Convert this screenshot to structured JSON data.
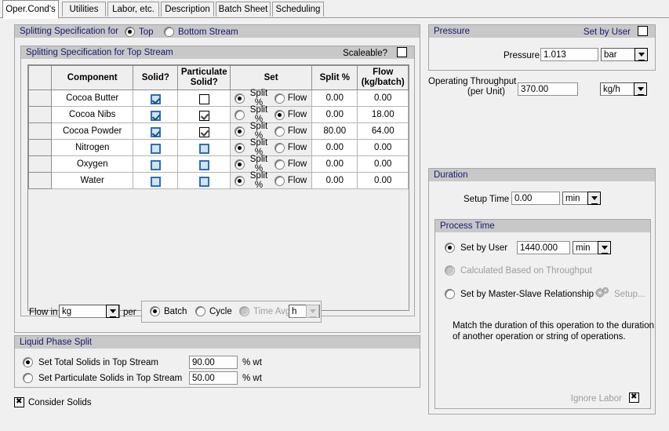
{
  "tabs": [
    {
      "label": "Oper.Cond's",
      "active": true
    },
    {
      "label": "Utilities",
      "active": false
    },
    {
      "label": "Labor, etc.",
      "active": false
    },
    {
      "label": "Description",
      "active": false
    },
    {
      "label": "Batch Sheet",
      "active": false
    },
    {
      "label": "Scheduling",
      "active": false
    }
  ],
  "splitting": {
    "title": "Splitting Specification for",
    "option_top": "Top",
    "option_bottom": "Bottom Stream",
    "selected": "Top",
    "inner_title": "Splitting Specification for Top Stream",
    "scaleable_label": "Scaleable?",
    "scaleable_checked": false,
    "columns": [
      "",
      "Component",
      "Solid?",
      "Particulate Solid?",
      "Set",
      "Split %",
      "Flow (kg/batch)"
    ],
    "column_flow_line1": "Flow",
    "column_flow_line2": "(kg/batch)",
    "column_part_line1": "Particulate",
    "column_part_line2": "Solid?",
    "set_option_split": "Split %",
    "set_option_flow": "Flow",
    "rows": [
      {
        "component": "Cocoa Butter",
        "solid": "blue-checked",
        "particulate": "black-unchecked",
        "set": "Split %",
        "split_pct": "0.00",
        "flow": "0.00"
      },
      {
        "component": "Cocoa Nibs",
        "solid": "blue-checked",
        "particulate": "black-checked",
        "set": "Flow",
        "split_pct": "0.00",
        "flow": "18.00"
      },
      {
        "component": "Cocoa Powder",
        "solid": "blue-checked",
        "particulate": "black-checked",
        "set": "Split %",
        "split_pct": "80.00",
        "flow": "64.00"
      },
      {
        "component": "Nitrogen",
        "solid": "blue-empty",
        "particulate": "blue-empty",
        "set": "Split %",
        "split_pct": "0.00",
        "flow": "0.00"
      },
      {
        "component": "Oxygen",
        "solid": "blue-empty",
        "particulate": "blue-empty",
        "set": "Split %",
        "split_pct": "0.00",
        "flow": "0.00"
      },
      {
        "component": "Water",
        "solid": "blue-empty",
        "particulate": "blue-empty",
        "set": "Split %",
        "split_pct": "0.00",
        "flow": "0.00"
      }
    ],
    "flow_in_label": "Flow in",
    "flow_in_value": "kg",
    "per_label": "per",
    "basis_batch": "Batch",
    "basis_cycle": "Cycle",
    "basis_timeavg": "Time Avg",
    "basis_selected": "Batch",
    "timeavg_unit": "h"
  },
  "liquid_phase": {
    "title": "Liquid Phase Split",
    "option_total": "Set Total Solids in Top Stream",
    "option_total_value": "90.00",
    "option_total_unit": "% wt",
    "option_particulate": "Set Particulate Solids in Top Stream",
    "option_particulate_value": "50.00",
    "option_particulate_unit": "% wt",
    "selected": "Set Total Solids in Top Stream"
  },
  "consider_solids": {
    "label": "Consider Solids",
    "checked": true
  },
  "pressure": {
    "title": "Pressure",
    "set_by_user_label": "Set by User",
    "set_by_user_checked": false,
    "field_label": "Pressure",
    "value": "1.013",
    "unit": "bar"
  },
  "throughput": {
    "label_line1": "Operating Throughput",
    "label_line2": "(per Unit)",
    "value": "370.00",
    "unit": "kg/h"
  },
  "duration": {
    "title": "Duration",
    "setup_time_label": "Setup Time",
    "setup_time_value": "0.00",
    "setup_time_unit": "min",
    "process_time": {
      "title": "Process Time",
      "option_user": "Set by User",
      "user_value": "1440.000",
      "user_unit": "min",
      "option_calculated": "Calculated Based on Throughput",
      "option_master_slave": "Set by Master-Slave Relationship",
      "setup_button": "Setup...",
      "selected": "Set by User",
      "description_line1": "Match the duration of this operation to the duration",
      "description_line2": "of another operation or string of operations.",
      "ignore_labor_label": "Ignore Labor",
      "ignore_labor_checked": true
    }
  },
  "colors": {
    "title_bar": "#c8c8c8",
    "title_text": "#191970",
    "panel_bg": "#f0f0f0",
    "checkbox_blue": "#2f6fa8",
    "disabled_text": "#9d9d9d"
  }
}
